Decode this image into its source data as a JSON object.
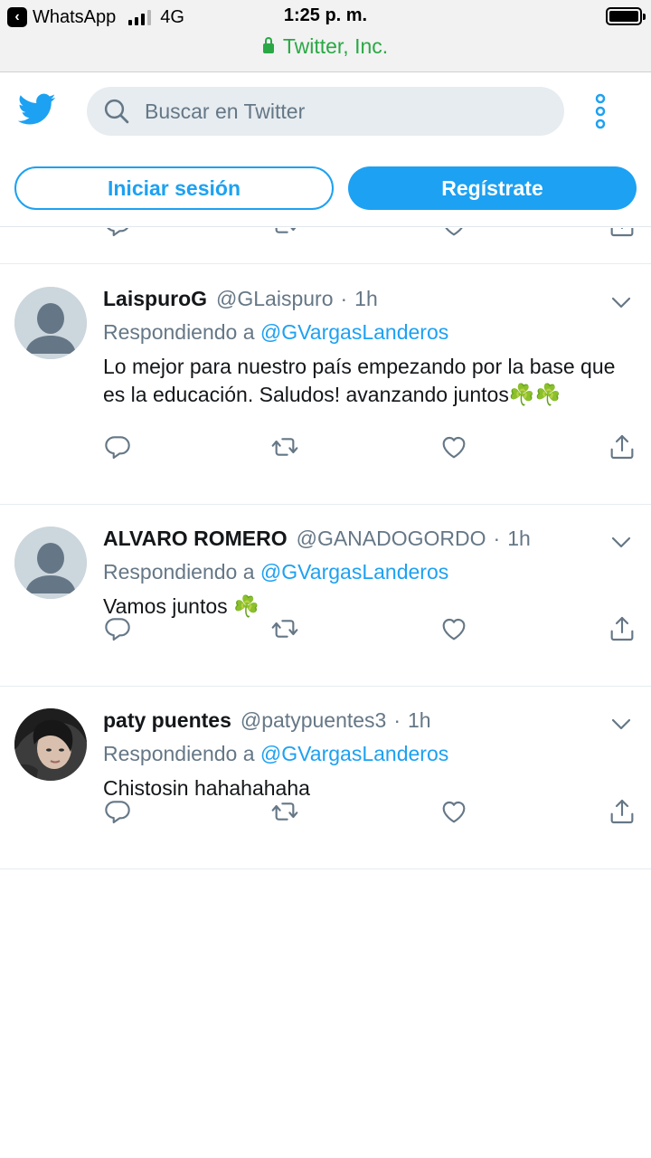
{
  "status_bar": {
    "back_app": "WhatsApp",
    "network": "4G",
    "time": "1:25 p. m.",
    "site": "Twitter, Inc."
  },
  "header": {
    "search_placeholder": "Buscar en Twitter",
    "login_label": "Iniciar sesión",
    "signup_label": "Regístrate"
  },
  "colors": {
    "accent": "#1da1f2",
    "secure": "#2aa845",
    "muted": "#657786"
  },
  "tweets": [
    {
      "name": "LaispuroG",
      "handle": "@GLaispuro",
      "separator": "·",
      "time": "1h",
      "reply_prefix": "Respondiendo a",
      "reply_to": "@GVargasLanderos",
      "text": "Lo mejor para nuestro país empezando por la base que es la educación. Saludos! avanzando juntos☘️☘️",
      "avatar": "default-avatar"
    },
    {
      "name": "ALVARO ROMERO",
      "handle": "@GANADOGORDO",
      "separator": "·",
      "time": "1h",
      "reply_prefix": "Respondiendo a",
      "reply_to": "@GVargasLanderos",
      "text": "Vamos juntos ☘️",
      "avatar": "default-avatar"
    },
    {
      "name": "paty puentes",
      "handle": "@patypuentes3",
      "separator": "·",
      "time": "1h",
      "reply_prefix": "Respondiendo a",
      "reply_to": "@GVargasLanderos",
      "text": "Chistosin hahahahaha",
      "avatar": "photo-avatar"
    }
  ]
}
